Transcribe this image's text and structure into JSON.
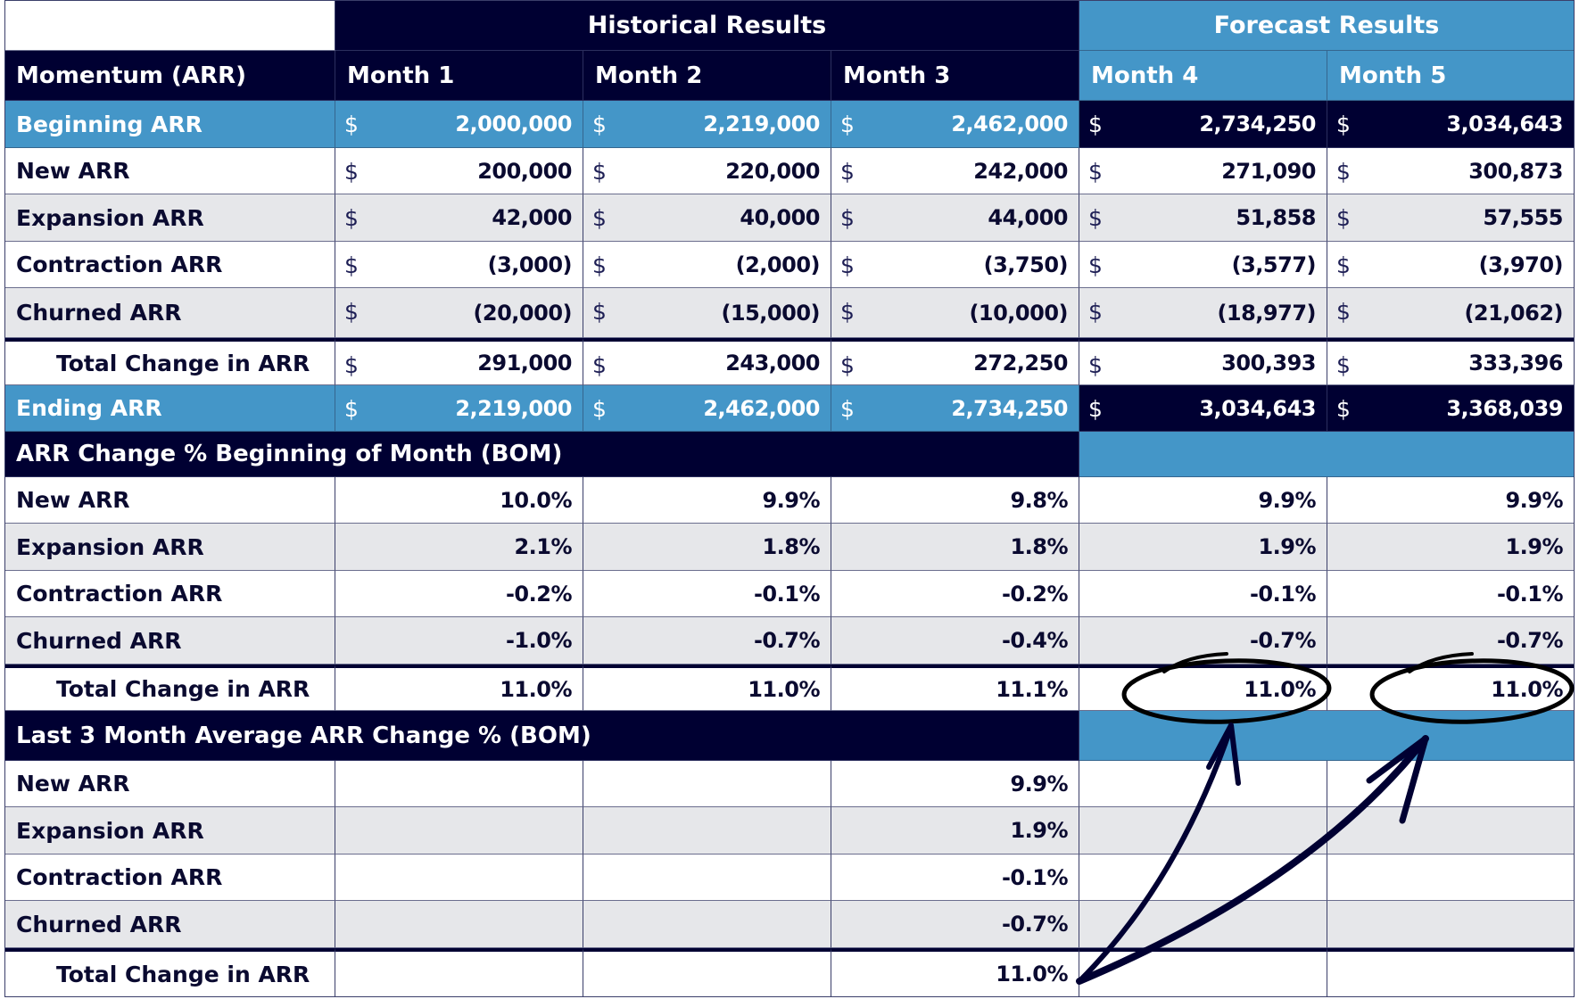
{
  "header": {
    "historical_label": "Historical Results",
    "forecast_label": "Forecast Results",
    "corner_label": "Momentum (ARR)",
    "months": [
      "Month 1",
      "Month 2",
      "Month 3",
      "Month 4",
      "Month 5"
    ]
  },
  "currency_symbol": "$",
  "momentum_rows": [
    {
      "label": "Beginning ARR",
      "values": [
        "2,000,000",
        "2,219,000",
        "2,462,000",
        "2,734,250",
        "3,034,643"
      ]
    },
    {
      "label": "New ARR",
      "values": [
        "200,000",
        "220,000",
        "242,000",
        "271,090",
        "300,873"
      ]
    },
    {
      "label": "Expansion ARR",
      "values": [
        "42,000",
        "40,000",
        "44,000",
        "51,858",
        "57,555"
      ]
    },
    {
      "label": "Contraction ARR",
      "values": [
        "(3,000)",
        "(2,000)",
        "(3,750)",
        "(3,577)",
        "(3,970)"
      ]
    },
    {
      "label": "Churned ARR",
      "values": [
        "(20,000)",
        "(15,000)",
        "(10,000)",
        "(18,977)",
        "(21,062)"
      ]
    },
    {
      "label": "Total Change in ARR",
      "values": [
        "291,000",
        "243,000",
        "272,250",
        "300,393",
        "333,396"
      ]
    },
    {
      "label": "Ending ARR",
      "values": [
        "2,219,000",
        "2,462,000",
        "2,734,250",
        "3,034,643",
        "3,368,039"
      ]
    }
  ],
  "bom_section": {
    "title": "ARR Change % Beginning of Month (BOM)",
    "rows": [
      {
        "label": "New ARR",
        "values": [
          "10.0%",
          "9.9%",
          "9.8%",
          "9.9%",
          "9.9%"
        ]
      },
      {
        "label": "Expansion ARR",
        "values": [
          "2.1%",
          "1.8%",
          "1.8%",
          "1.9%",
          "1.9%"
        ]
      },
      {
        "label": "Contraction ARR",
        "values": [
          "-0.2%",
          "-0.1%",
          "-0.2%",
          "-0.1%",
          "-0.1%"
        ]
      },
      {
        "label": "Churned ARR",
        "values": [
          "-1.0%",
          "-0.7%",
          "-0.4%",
          "-0.7%",
          "-0.7%"
        ]
      },
      {
        "label": "Total Change in ARR",
        "values": [
          "11.0%",
          "11.0%",
          "11.1%",
          "11.0%",
          "11.0%"
        ]
      }
    ]
  },
  "avg_section": {
    "title": "Last 3 Month Average ARR Change % (BOM)",
    "rows": [
      {
        "label": "New ARR",
        "values": [
          "",
          "",
          "9.9%",
          "",
          ""
        ]
      },
      {
        "label": "Expansion ARR",
        "values": [
          "",
          "",
          "1.9%",
          "",
          ""
        ]
      },
      {
        "label": "Contraction ARR",
        "values": [
          "",
          "",
          "-0.1%",
          "",
          ""
        ]
      },
      {
        "label": "Churned ARR",
        "values": [
          "",
          "",
          "-0.7%",
          "",
          ""
        ]
      },
      {
        "label": "Total Change in ARR",
        "values": [
          "",
          "",
          "11.0%",
          "",
          ""
        ]
      }
    ]
  },
  "annotations": {
    "circled_cells": [
      "Month 4 Total Change in ARR (BOM %)",
      "Month 5 Total Change in ARR (BOM %)"
    ],
    "arrows_from": "Month 3 Last 3 Month Average Total Change in ARR"
  },
  "colors": {
    "navy": "#000032",
    "blue": "#4496c8",
    "gray_row": "#e6e7ea"
  }
}
